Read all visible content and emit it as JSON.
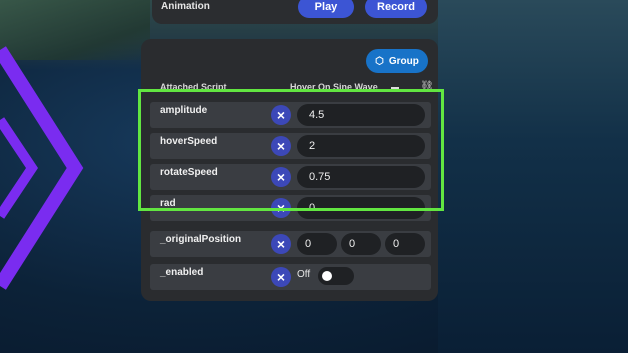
{
  "top": {
    "animation_label": "Animation",
    "play_label": "Play",
    "record_label": "Record"
  },
  "panel": {
    "group_label": "Group",
    "attached_label": "Attached Script",
    "script_name": "Hover On Sine Wave"
  },
  "rows": [
    {
      "label": "amplitude",
      "value": "4.5"
    },
    {
      "label": "hoverSpeed",
      "value": "2"
    },
    {
      "label": "rotateSpeed",
      "value": "0.75"
    },
    {
      "label": "rad",
      "value": "0"
    },
    {
      "label": "_originalPosition",
      "x": "0",
      "y": "0",
      "z": "0"
    },
    {
      "label": "_enabled",
      "value": "Off"
    }
  ],
  "colors": {
    "accent_blue": "#3c55d4",
    "group_blue": "#1873c8",
    "highlight_green": "#62e641",
    "arrow_purple": "#7a2cf0"
  },
  "icons": {
    "clear": "×",
    "group": "cube-icon",
    "link": "unlink-icon"
  }
}
